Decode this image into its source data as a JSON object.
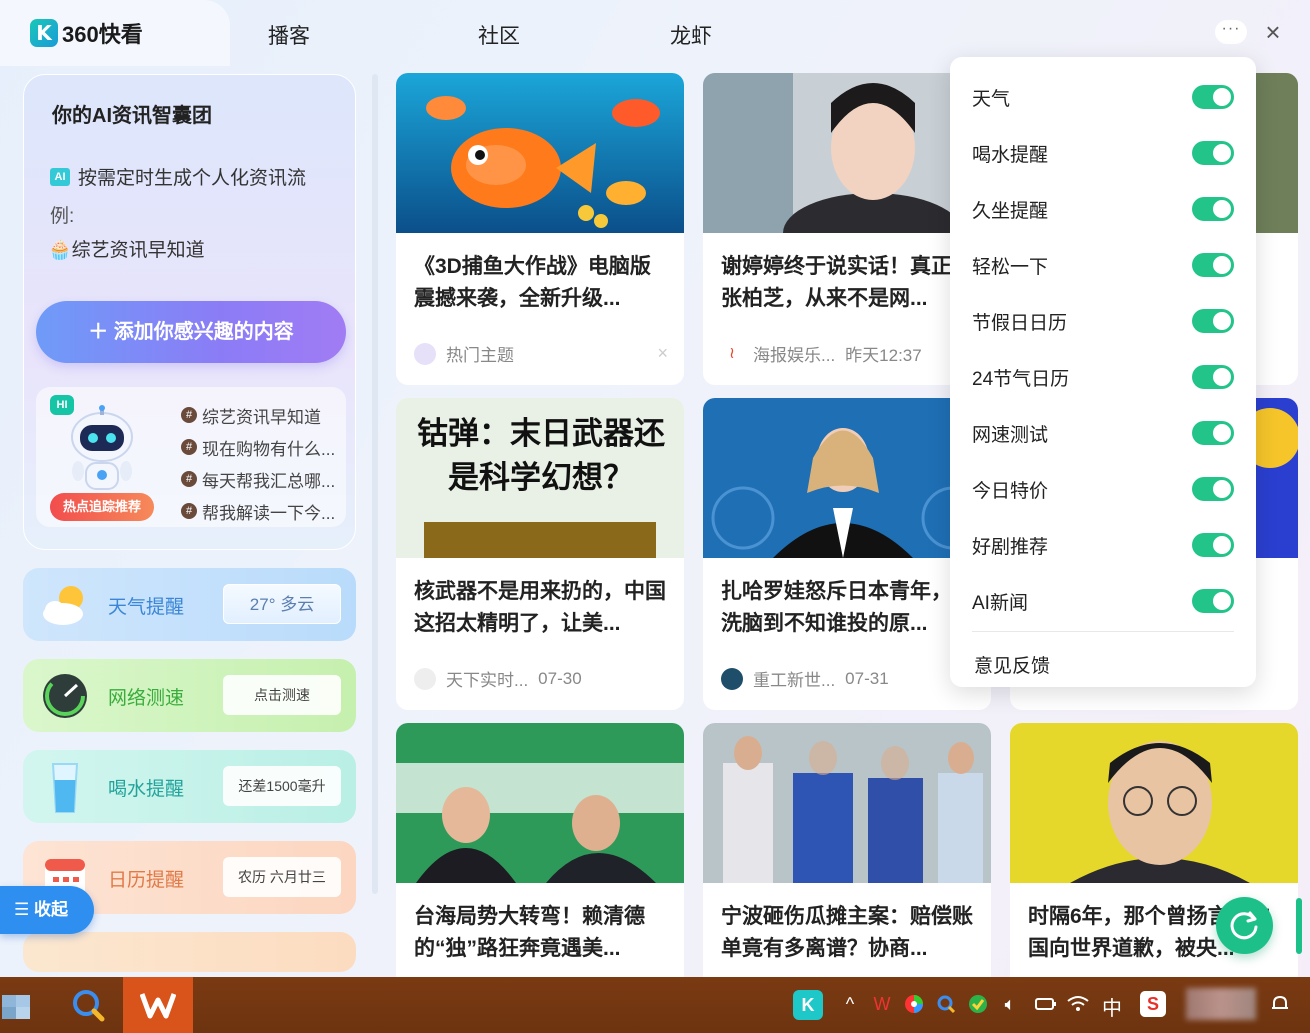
{
  "app": {
    "logo_badge": "K",
    "logo_text": "360快看"
  },
  "nav": {
    "tabs": [
      "播客",
      "社区",
      "龙虾"
    ],
    "more": "···",
    "close": "×"
  },
  "ai_panel": {
    "title": "你的AI资讯智囊团",
    "chip": "AI",
    "line": "按需定时生成个人化资讯流",
    "example_label": "例:",
    "example": "🧁综艺资讯早知道",
    "add_button": "＋ 添加你感兴趣的内容",
    "hi": "HI",
    "hot_tag": "热点追踪推荐",
    "hot_items": [
      "综艺资讯早知道",
      "现在购物有什么...",
      "每天帮我汇总哪...",
      "帮我解读一下今..."
    ]
  },
  "tools": {
    "weather": {
      "label": "天气提醒",
      "value": "27° 多云"
    },
    "network": {
      "label": "网络测速",
      "value": "点击测速"
    },
    "water": {
      "label": "喝水提醒",
      "value": "还差1500毫升"
    },
    "calendar": {
      "label": "日历提醒",
      "value": "农历 六月廿三"
    }
  },
  "collapse": "☰ 收起",
  "feed": [
    {
      "title": "《3D捕鱼大作战》电脑版震撼来袭，全新升级...",
      "source": "热门主题",
      "time": ""
    },
    {
      "title": "谢婷婷终于说实话！真正的张柏芝，从来不是网...",
      "source": "海报娱乐...",
      "time": "昨天12:37"
    },
    {
      "title": "核武器不是用来扔的，中国这招太精明了，让美...",
      "source": "天下实时...",
      "time": "07-30"
    },
    {
      "title": "扎哈罗娃怒斥日本青年，被洗脑到不知谁投的原...",
      "source": "重工新世...",
      "time": "07-31"
    },
    {
      "title": "台海局势大转弯！赖清德的“独”路狂奔竟遇美...",
      "source": "",
      "time": ""
    },
    {
      "title": "宁波砸伤瓜摊主案：赔偿账单竟有多离谱？协商...",
      "source": "",
      "time": ""
    },
    {
      "title": "时隔6年，那个曾扬言让中国向世界道歉，被央...",
      "source": "",
      "time": ""
    }
  ],
  "thumb_texts": {
    "missile": "钴弹：末日武器还是科学幻想？"
  },
  "settings_menu": {
    "items": [
      "天气",
      "喝水提醒",
      "久坐提醒",
      "轻松一下",
      "节假日日历",
      "24节气日历",
      "网速测试",
      "今日特价",
      "好剧推荐",
      "AI新闻"
    ],
    "toggles_on": [
      true,
      true,
      true,
      true,
      true,
      true,
      true,
      true,
      true,
      true
    ],
    "feedback": "意见反馈"
  },
  "taskbar": {
    "ime": "中",
    "colors": {
      "bar": "#7a3a12",
      "active": "#d9541a",
      "accent": "#1ec08a"
    }
  }
}
